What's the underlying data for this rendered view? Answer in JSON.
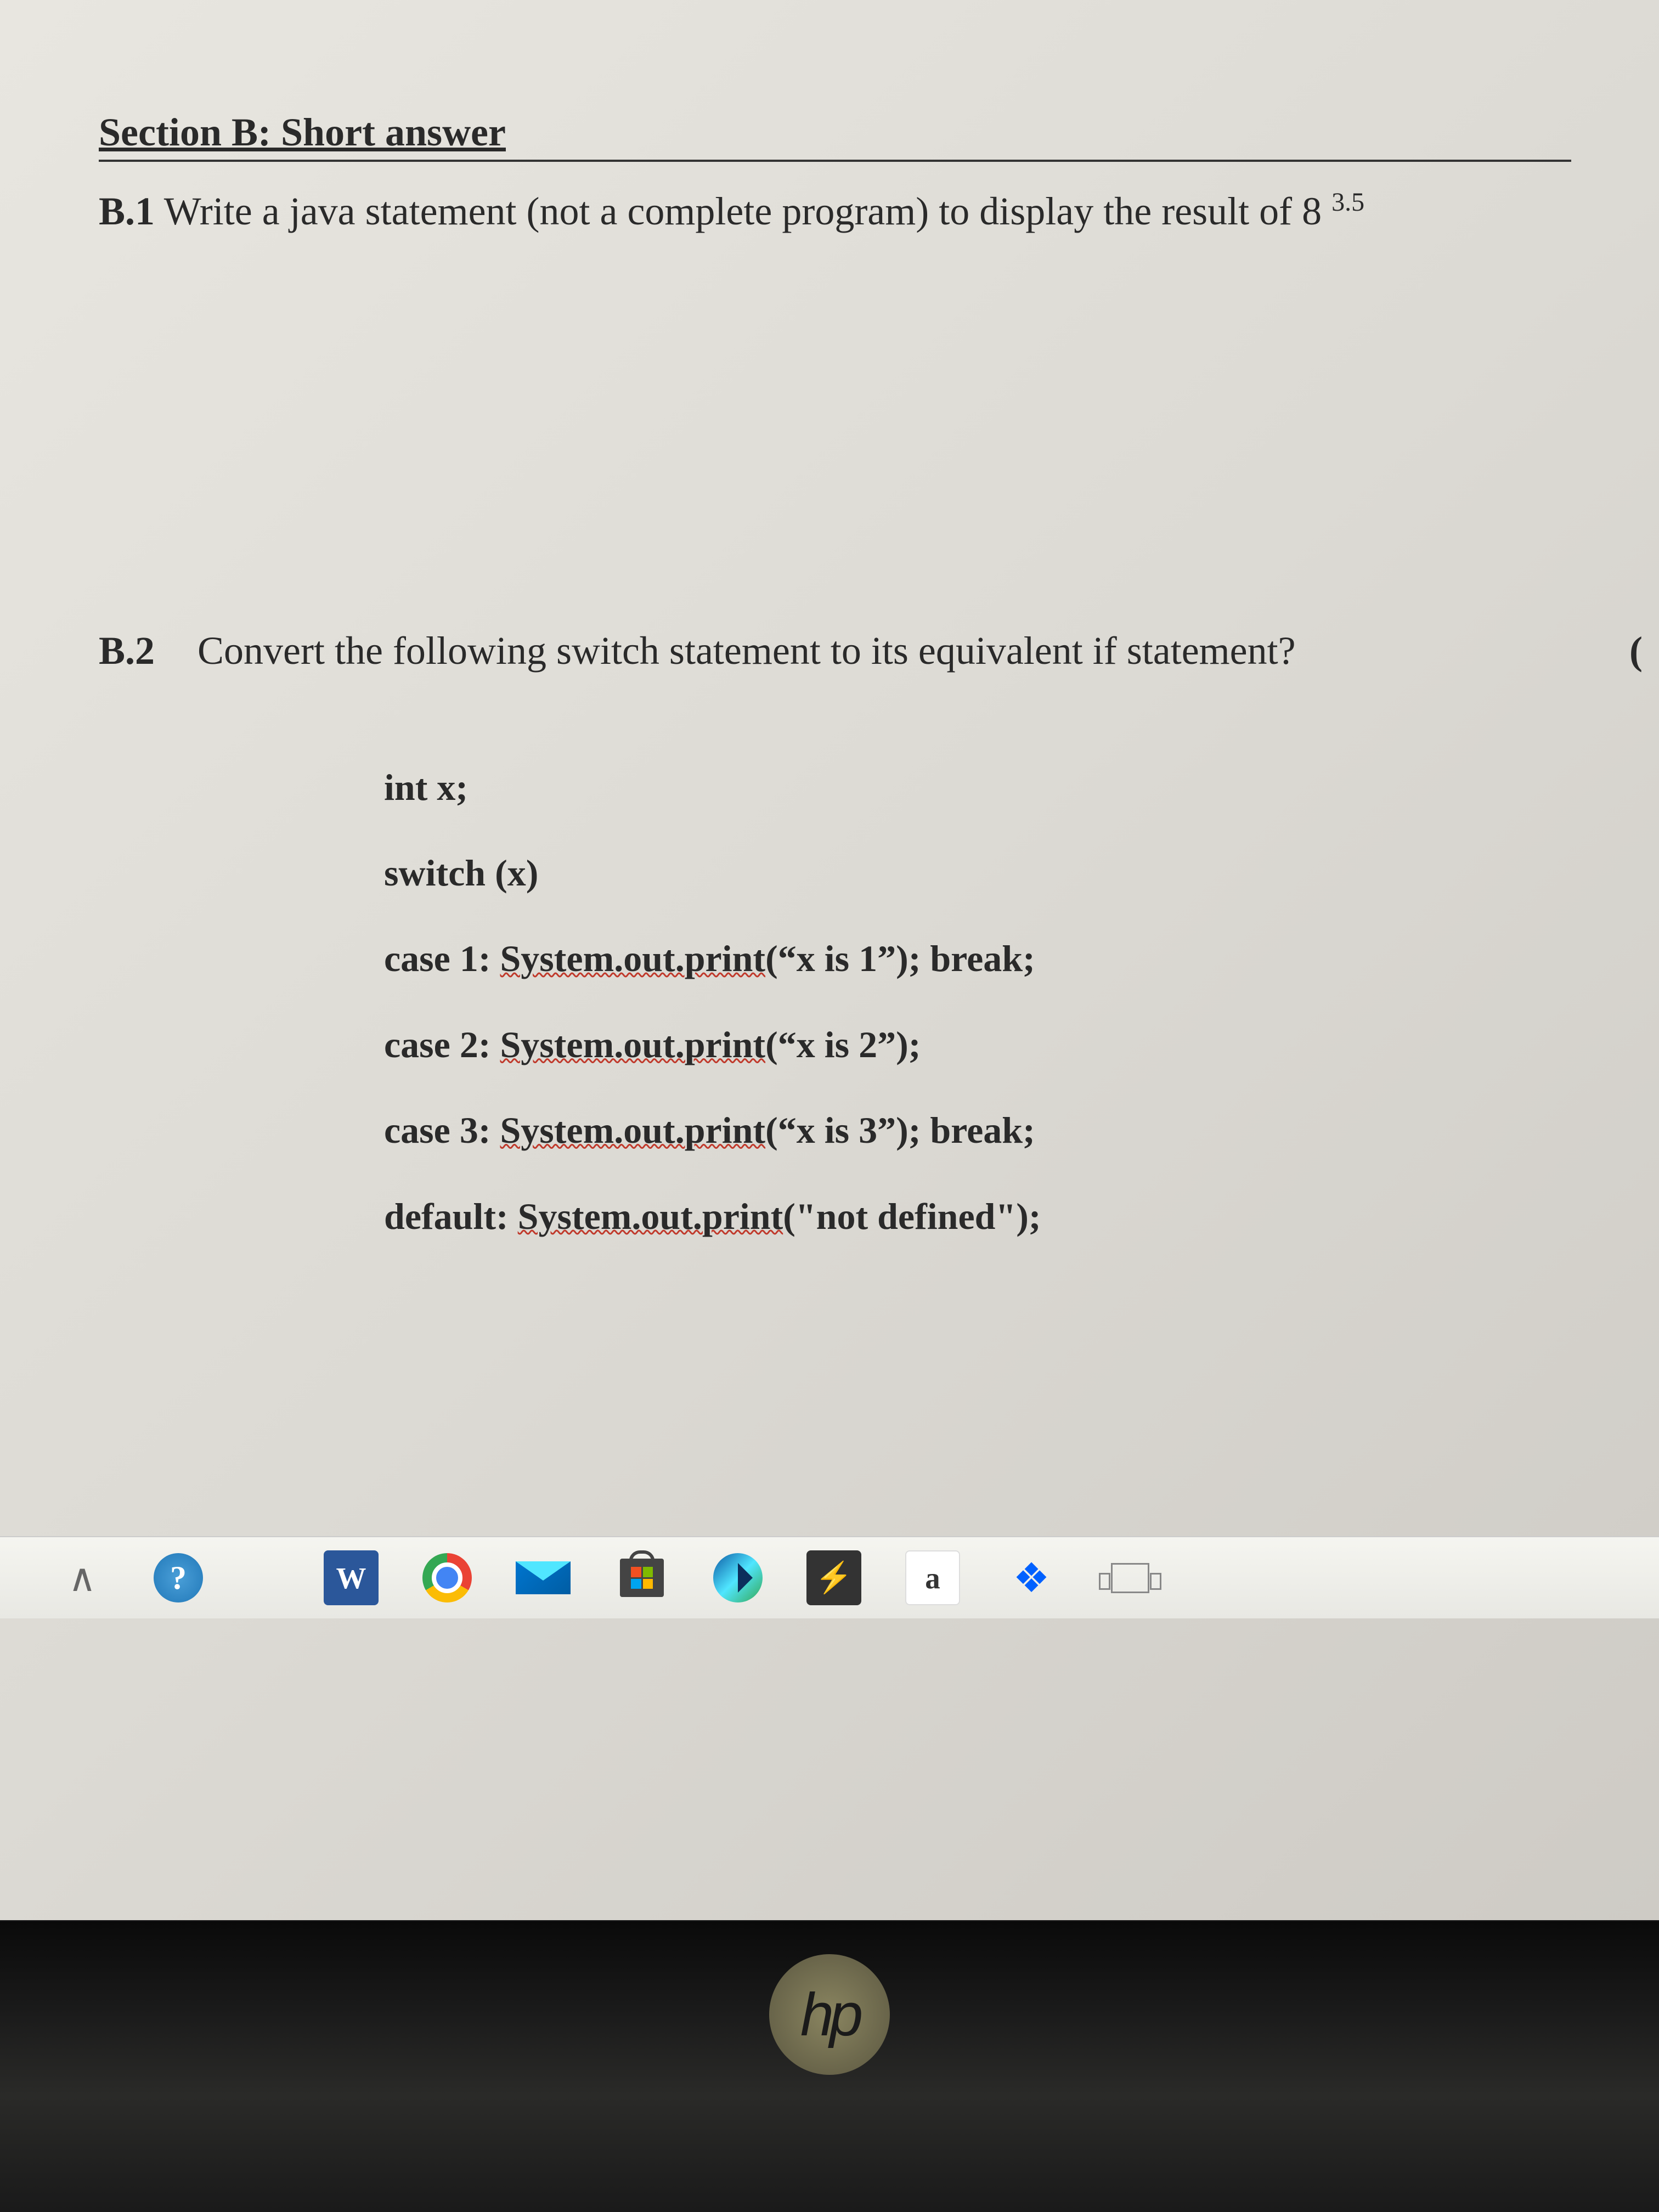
{
  "section": {
    "header": "Section B: Short answer"
  },
  "q1": {
    "label": "B.1",
    "text": "Write a java statement (not a complete program) to display the result of 8",
    "exponent": "3.5"
  },
  "q2": {
    "label": "B.2",
    "text": "Convert the following switch statement to its equivalent if statement?",
    "paren": "("
  },
  "code": {
    "line1": "int x;",
    "line2": "switch (x)",
    "line3_pre": "case 1: ",
    "line3_mid": "System.out.print",
    "line3_post": "(“x is 1”); break;",
    "line4_pre": "case 2: ",
    "line4_mid": "System.out.print",
    "line4_post": "(“x is 2”);",
    "line5_pre": "case 3: ",
    "line5_mid": "System.out.print",
    "line5_post": "(“x is 3”); break;",
    "line6_pre": "default: ",
    "line6_mid": "System.out.print",
    "line6_post": "(\"not defined\");"
  },
  "taskbar": {
    "chevron": "∧",
    "help": "?",
    "word": "W",
    "bolt": "⚡",
    "amazon": "a",
    "dropbox": "❖"
  },
  "logo": {
    "hp": "hp"
  }
}
